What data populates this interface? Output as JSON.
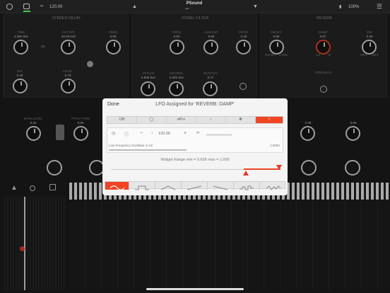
{
  "topbar": {
    "bpm": "120.00",
    "title": "PSound",
    "battery": "100%"
  },
  "panels": {
    "stereo_delay": {
      "title": "STEREO DELAY",
      "time": {
        "label": "TIME",
        "value": "0.300 Sec"
      },
      "cutoff": {
        "label": "CUTOFF",
        "value": "20.00 kHz"
      },
      "feed": {
        "label": "FEED",
        "value": "0.50"
      },
      "mix": {
        "label": "MIX",
        "value": "0.40"
      },
      "level": {
        "label": "LEVEL",
        "value": "0.70"
      }
    },
    "vowel_filter": {
      "title": "VOWEL FILTER",
      "freq": {
        "label": "FREQ",
        "value": "0.50"
      },
      "amount": {
        "label": "AMOUNT",
        "value": "0.80"
      },
      "drive": {
        "label": "DRIVE",
        "value": "0.30"
      },
      "attack": {
        "label": "ATTACK",
        "value": "0.500 Sec"
      },
      "decrel": {
        "label": "DEC/REL",
        "value": "0.500 Sec"
      },
      "sustain": {
        "label": "SUSTAIN",
        "value": "0.17"
      }
    },
    "reverb": {
      "title": "REVERB",
      "decay": {
        "label": "DECAY",
        "value": "0.80"
      },
      "damp": {
        "label": "DAMP",
        "value": "0.67"
      },
      "mix": {
        "label": "MIX",
        "value": "0.30"
      },
      "predelay": "PREDELAY",
      "short": "SHORT",
      "long": "LONG",
      "lo": "LO",
      "hi": "HI",
      "dry": "DRY",
      "wet": "WET"
    }
  },
  "main": {
    "main_level": {
      "label": "MAIN LEVEL",
      "value": "0.40"
    },
    "pitch_trim": {
      "label": "PITCH TRIM",
      "value": "0.00"
    },
    "k1": "0.35",
    "k2": "0.00"
  },
  "modal": {
    "done": "Done",
    "title": "LFO Assigned for 'REVERB: DAMP'",
    "modes": [
      "Off",
      "",
      "ePr+",
      "",
      "",
      ""
    ],
    "rate": "120.00",
    "description": "Low Frequency Oscillator in Hz",
    "freq_value": "1.0000",
    "range_label": "Widget Range min = 0.636 max = 1.000"
  }
}
